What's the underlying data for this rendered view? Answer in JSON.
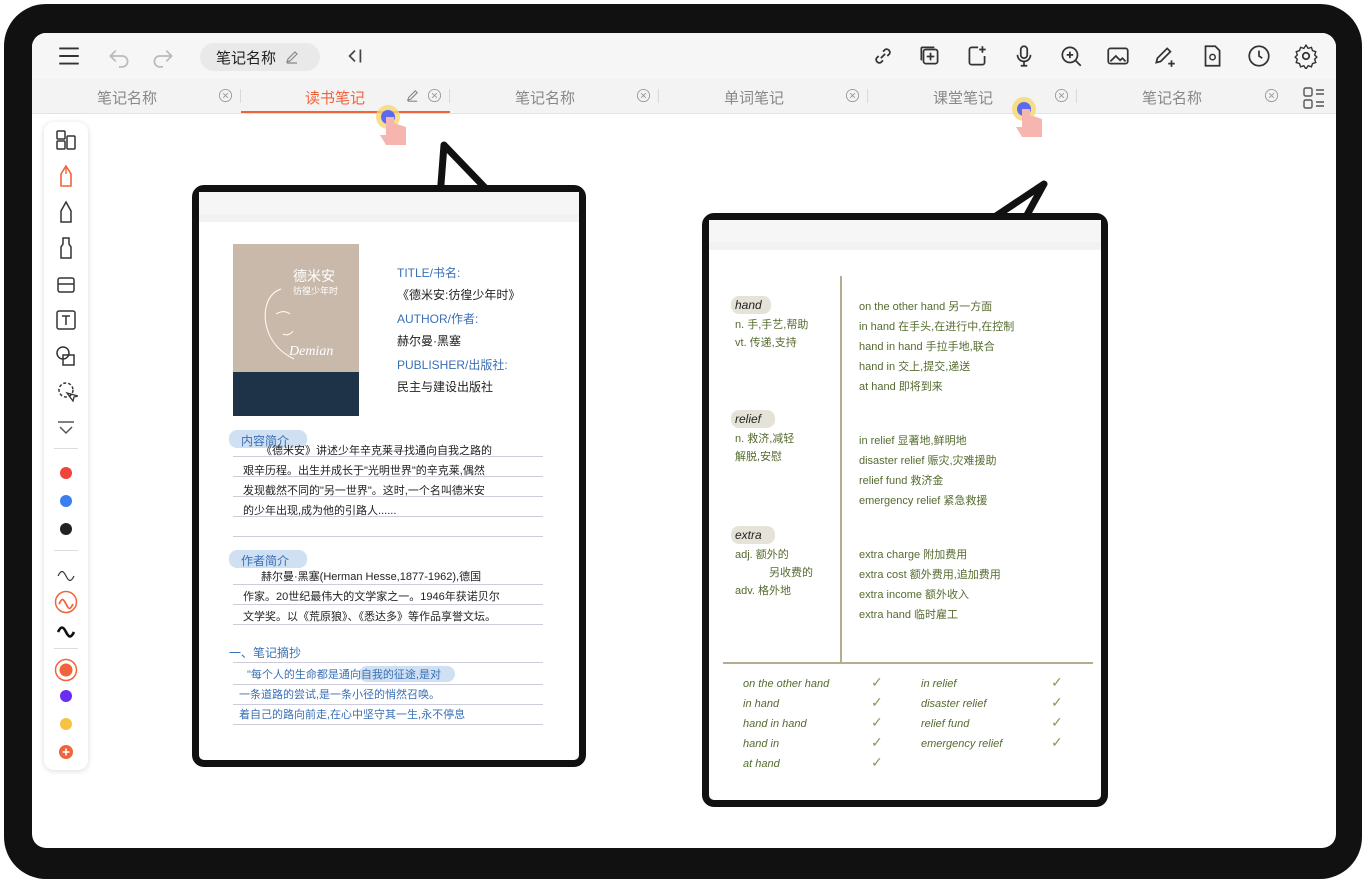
{
  "toolbar": {
    "note_name": "笔记名称",
    "left_icons": [
      "menu-icon",
      "undo-icon",
      "redo-icon"
    ],
    "collapse_icon": "collapse-panel-icon",
    "right_icons": [
      "link-icon",
      "add-page-icon",
      "insert-page-icon",
      "microphone-icon",
      "zoom-in-icon",
      "image-icon",
      "pen-add-icon",
      "preview-icon",
      "clock-icon",
      "settings-icon"
    ]
  },
  "tabs": [
    {
      "label": "笔记名称",
      "active": false
    },
    {
      "label": "读书笔记",
      "active": true
    },
    {
      "label": "笔记名称",
      "active": false
    },
    {
      "label": "单词笔记",
      "active": false
    },
    {
      "label": "课堂笔记",
      "active": false
    },
    {
      "label": "笔记名称",
      "active": false
    }
  ],
  "palette": {
    "tools": [
      "pages-icon",
      "fountain-pen-icon",
      "pen-icon",
      "marker-icon",
      "eraser-icon",
      "text-icon",
      "shape-icon",
      "lasso-icon",
      "collapse-icon"
    ],
    "colors": [
      "#f0443a",
      "#3a7ff0",
      "#222222"
    ],
    "stroke_colors": [
      "#333333",
      "#f0643c",
      "#111111"
    ],
    "extra_colors": [
      "#f0643c",
      "#6a2cf0",
      "#f5c242"
    ],
    "accent": "#f0643c"
  },
  "reading_note": {
    "book_title": "德米安",
    "book_subtitle": "彷徨少年时",
    "cover_script": "Demian",
    "title_label": "TITLE/书名:",
    "title_value": "《德米安:彷徨少年时》",
    "author_label": "AUTHOR/作者:",
    "author_value": "赫尔曼·黑塞",
    "publisher_label": "PUBLISHER/出版社:",
    "publisher_value": "民主与建设出版社",
    "summary_heading": "内容简介",
    "summary_lines": [
      "《德米安》讲述少年辛克莱寻找通向自我之路的",
      "艰辛历程。出生并成长于\"光明世界\"的辛克莱,偶然",
      "发现截然不同的\"另一世界\"。这时,一个名叫德米安",
      "的少年出现,成为他的引路人......"
    ],
    "author_heading": "作者简介",
    "author_lines": [
      "赫尔曼·黑塞(Herman Hesse,1877-1962),德国",
      "作家。20世纪最伟大的文学家之一。1946年获诺贝尔",
      "文学奖。以《荒原狼》、《悉达多》等作品享誉文坛。"
    ],
    "excerpt_heading": "一、笔记摘抄",
    "excerpt_lines": [
      "\"每个人的生命都是通向自我的征途,是对",
      "一条道路的尝试,是一条小径的悄然召唤。",
      "着自己的路向前走,在心中坚守其一生,永不停息"
    ]
  },
  "word_note": {
    "entries": [
      {
        "word": "hand",
        "meanings": [
          "n. 手,手艺,帮助",
          "vt. 传递,支持"
        ],
        "phrases": [
          "on the other hand 另一方面",
          "in hand 在手头,在进行中,在控制",
          "hand in hand 手拉手地,联合",
          "hand in 交上,提交,递送",
          "at hand 即将到来"
        ]
      },
      {
        "word": "relief",
        "meanings": [
          "n. 救济,减轻",
          "解脱,安慰"
        ],
        "phrases": [
          "in relief 显著地,鲜明地",
          "disaster relief 赈灾,灾难援助",
          "relief fund 救济金",
          "emergency relief 紧急救援"
        ]
      },
      {
        "word": "extra",
        "meanings": [
          "adj. 额外的",
          "另收费的",
          "adv. 格外地"
        ],
        "phrases": [
          "extra charge 附加费用",
          "extra cost 额外费用,追加费用",
          "extra income 额外收入",
          "extra hand 临时雇工"
        ]
      }
    ],
    "review_left": [
      "on the other hand",
      "in hand",
      "hand in hand",
      "hand in",
      "at hand"
    ],
    "review_right": [
      "in relief",
      "disaster relief",
      "relief fund",
      "emergency relief"
    ],
    "check_mark": "✓"
  }
}
